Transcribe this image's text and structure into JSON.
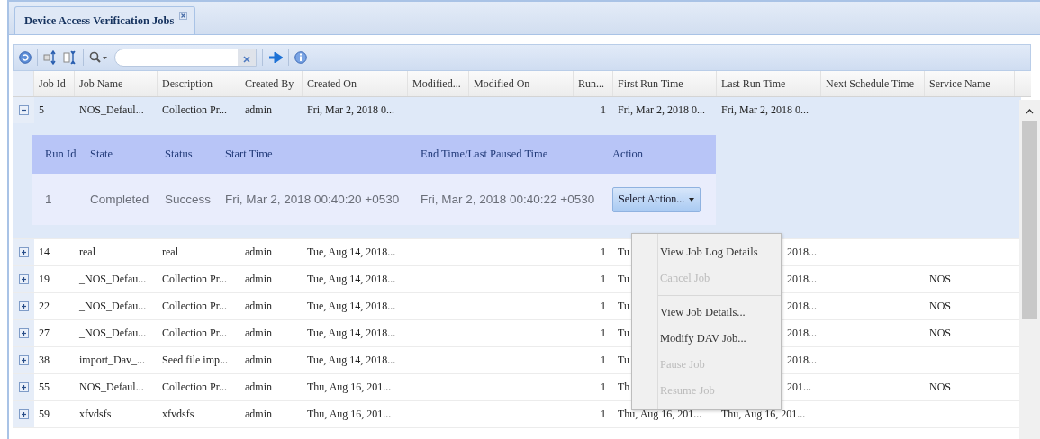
{
  "tab": {
    "label": "Device Access Verification Jobs",
    "closable": true
  },
  "columns": [
    "Job Id",
    "Job Name",
    "Description",
    "Created By",
    "Created On",
    "Modified...",
    "Modified On",
    "Run...",
    "First Run Time",
    "Last Run Time",
    "Next Schedule Time",
    "Service Name"
  ],
  "rows": [
    {
      "expanded": true,
      "cells": [
        "5",
        "NOS_Defaul...",
        "Collection Pr...",
        "admin",
        "Fri, Mar 2, 2018 0...",
        null,
        null,
        "1",
        "Fri, Mar 2, 2018 0...",
        "Fri, Mar 2, 2018 0...",
        null,
        null
      ],
      "details": {
        "columns": [
          "Run Id",
          "State",
          "Status",
          "Start Time",
          "End Time/Last Paused Time",
          "Action"
        ],
        "rows": [
          {
            "cells": [
              "1",
              "Completed",
              "Success",
              "Fri, Mar 2, 2018 00:40:20 +0530",
              "Fri, Mar 2, 2018 00:40:22 +0530"
            ],
            "action": "Select Action..."
          }
        ]
      }
    },
    {
      "expanded": false,
      "cells": [
        "14",
        "real",
        "real",
        "admin",
        "Tue, Aug 14, 2018...",
        null,
        null,
        "1",
        "Tu",
        "2018...",
        null,
        null
      ]
    },
    {
      "expanded": false,
      "cells": [
        "19",
        "_NOS_Defau...",
        "Collection Pr...",
        "admin",
        "Tue, Aug 14, 2018...",
        null,
        null,
        "1",
        "Tu",
        "2018...",
        null,
        "NOS"
      ]
    },
    {
      "expanded": false,
      "cells": [
        "22",
        "_NOS_Defau...",
        "Collection Pr...",
        "admin",
        "Tue, Aug 14, 2018...",
        null,
        null,
        "1",
        "Tu",
        "2018...",
        null,
        "NOS"
      ]
    },
    {
      "expanded": false,
      "cells": [
        "27",
        "_NOS_Defau...",
        "Collection Pr...",
        "admin",
        "Tue, Aug 14, 2018...",
        null,
        null,
        "1",
        "Tu",
        "2018...",
        null,
        "NOS"
      ]
    },
    {
      "expanded": false,
      "cells": [
        "38",
        "import_Dav_...",
        "Seed file imp...",
        "admin",
        "Tue, Aug 14, 2018...",
        null,
        null,
        "1",
        "Tu",
        "2018...",
        null,
        null
      ]
    },
    {
      "expanded": false,
      "cells": [
        "55",
        "NOS_Defaul...",
        "Collection Pr...",
        "admin",
        "Thu, Aug 16, 201...",
        null,
        null,
        "1",
        "Th",
        "201...",
        null,
        "NOS"
      ]
    },
    {
      "expanded": false,
      "cells": [
        "59",
        "xfvdsfs",
        "xfvdsfs",
        "admin",
        "Thu, Aug 16, 201...",
        null,
        null,
        "1",
        "Thu, Aug 16, 201...",
        "Thu, Aug 16, 201...",
        null,
        null
      ]
    }
  ],
  "action_menu": [
    {
      "kind": "item",
      "label": "View Job Log Details",
      "disabled": false
    },
    {
      "kind": "item",
      "label": "Cancel Job",
      "disabled": true
    },
    {
      "kind": "separator"
    },
    {
      "kind": "item",
      "label": "View Job Details...",
      "disabled": false
    },
    {
      "kind": "item",
      "label": "Modify DAV Job...",
      "disabled": false
    },
    {
      "kind": "item",
      "label": "Pause Job",
      "disabled": true
    },
    {
      "kind": "item",
      "label": "Resume Job",
      "disabled": true
    }
  ]
}
